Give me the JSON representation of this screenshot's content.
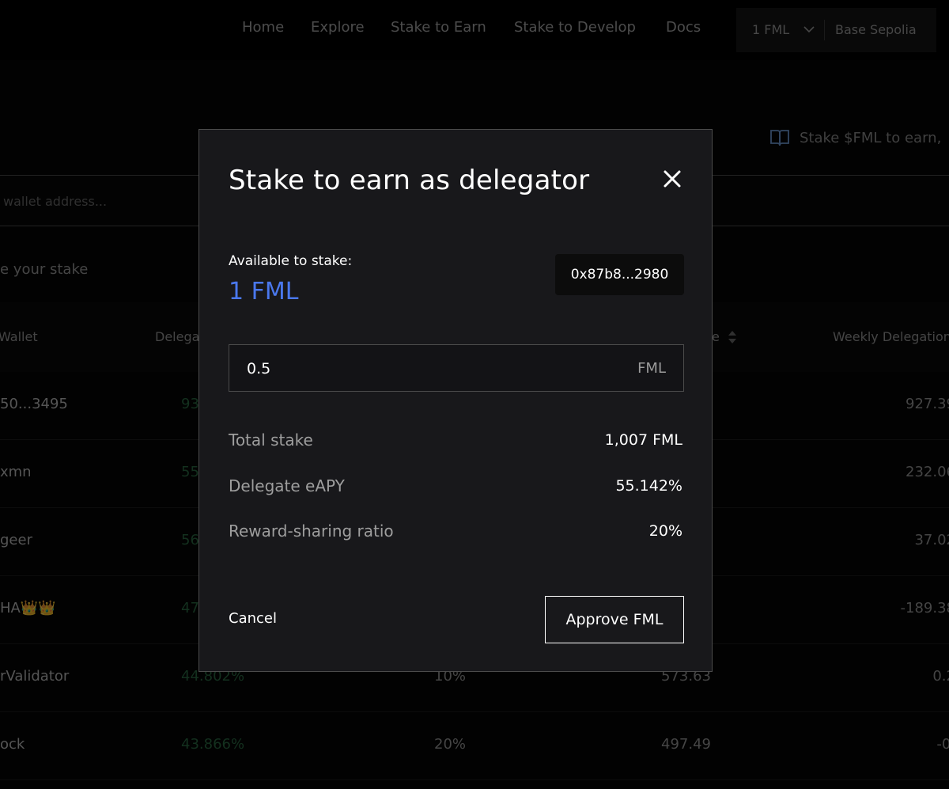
{
  "nav": {
    "links": [
      "Home",
      "Explore",
      "Stake to Earn",
      "Stake to Develop",
      "Docs"
    ],
    "wallet_balance": "1 FML",
    "network": "Base Sepolia"
  },
  "page": {
    "info_text": "Stake $FML to earn,",
    "search_placeholder": "wallet address...",
    "stake_hint": "e your stake",
    "table": {
      "headers": {
        "wallet": "Wallet",
        "delegate": "Delega",
        "stake": "e",
        "weekly": "Weekly Delegation"
      },
      "rows": [
        {
          "name": "50...3495",
          "eapy": "93",
          "ratio": "",
          "stake": "",
          "weekly": "927.39"
        },
        {
          "name": "xmn",
          "eapy": "55",
          "ratio": "",
          "stake": "",
          "weekly": "232.06"
        },
        {
          "name": "geer",
          "eapy": "56",
          "ratio": "",
          "stake": "",
          "weekly": "37.02"
        },
        {
          "name": "HA👑👑",
          "eapy": "47",
          "ratio": "",
          "stake": "",
          "weekly": "-189.38"
        },
        {
          "name": "rValidator",
          "eapy": "44.802%",
          "ratio": "10%",
          "stake": "573.63",
          "weekly": "0.2"
        },
        {
          "name": "ock",
          "eapy": "43.866%",
          "ratio": "20%",
          "stake": "497.49",
          "weekly": "-0."
        }
      ]
    }
  },
  "modal": {
    "title": "Stake to earn as delegator",
    "available_label": "Available to stake:",
    "available_value": "1 FML",
    "address": "0x87b8...2980",
    "amount_value": "0.5",
    "amount_unit": "FML",
    "stats": [
      {
        "label": "Total stake",
        "value": "1,007 FML"
      },
      {
        "label": "Delegate eAPY",
        "value": "55.142%"
      },
      {
        "label": "Reward-sharing ratio",
        "value": "20%"
      }
    ],
    "cancel_label": "Cancel",
    "approve_label": "Approve FML"
  },
  "colors": {
    "accent_blue": "#4a78ee",
    "eapy_green": "#2c6b44",
    "modal_bg": "#18181b"
  }
}
